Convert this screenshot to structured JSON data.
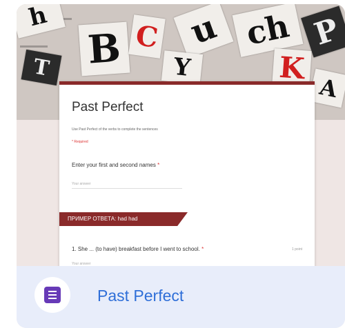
{
  "banner": {
    "letters": [
      "B",
      "C",
      "u",
      "ch",
      "K",
      "Y",
      "P",
      "T",
      "A",
      "h"
    ]
  },
  "form": {
    "title": "Past Perfect",
    "description": "Use Past Perfect of the verbs to complete the sentences",
    "required_note": "* Required",
    "questions": [
      {
        "label": "Enter your first and second names",
        "star": "*",
        "placeholder": "Your answer"
      },
      {
        "label": "1. She ... (to have) breakfast before I went to school.",
        "star": "*",
        "placeholder": "Your answer",
        "points": "1 point"
      }
    ],
    "section_header": "ПРИМЕР ОТВЕТА: had had"
  },
  "footer": {
    "icon": "google-forms-icon",
    "title": "Past Perfect"
  },
  "colors": {
    "accent": "#8a2a2a",
    "forms_purple": "#673ab7",
    "title_blue": "#2f6fd8",
    "footer_bg": "#e8edfa"
  }
}
